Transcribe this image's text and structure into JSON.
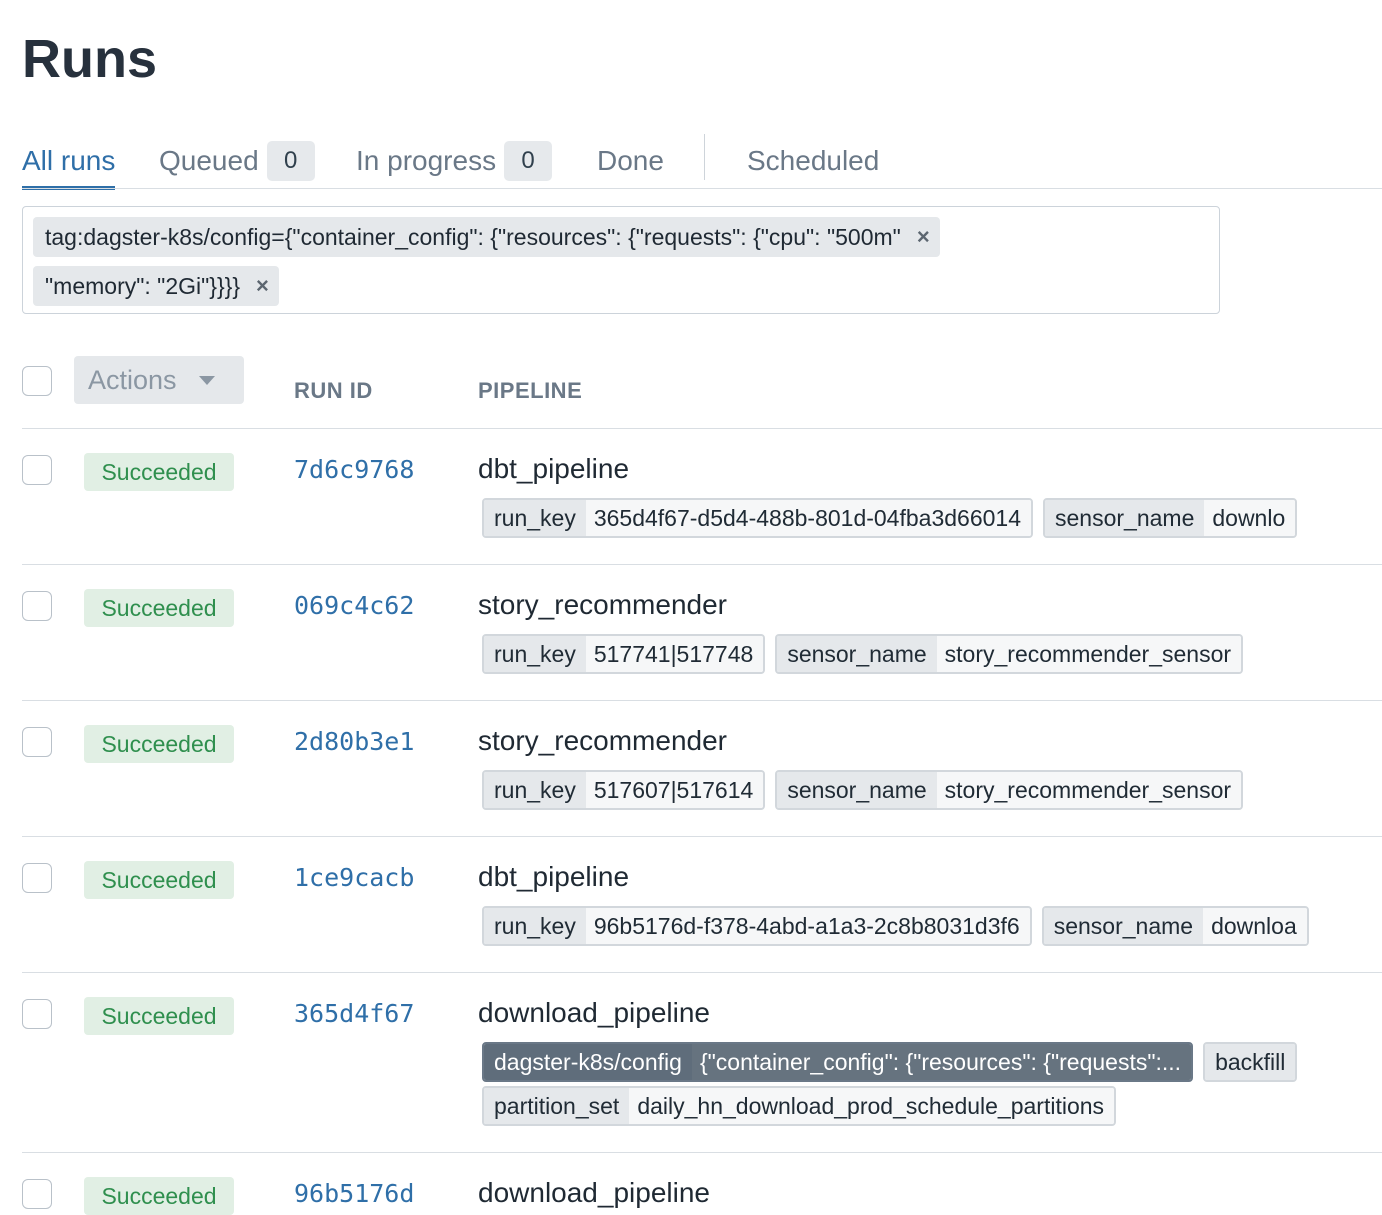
{
  "page": {
    "title": "Runs"
  },
  "tabs": [
    {
      "label": "All runs",
      "active": true
    },
    {
      "label": "Queued",
      "count": "0"
    },
    {
      "label": "In progress",
      "count": "0"
    },
    {
      "label": "Done"
    },
    {
      "label": "Scheduled"
    }
  ],
  "filter": {
    "line1": "tag:dagster-k8s/config={\"container_config\": {\"resources\": {\"requests\": {\"cpu\": \"500m\"",
    "line2": "\"memory\": \"2Gi\"}}}}",
    "remove_icon": "×"
  },
  "table": {
    "actions_label": "Actions",
    "col_run_id": "RUN ID",
    "col_pipeline": "PIPELINE"
  },
  "rows": [
    {
      "status": "Succeeded",
      "run_id": "7d6c9768",
      "pipeline": "dbt_pipeline",
      "tags": [
        {
          "k": "run_key",
          "v": "365d4f67-d5d4-488b-801d-04fba3d66014"
        },
        {
          "k": "sensor_name",
          "v": "downlo"
        }
      ]
    },
    {
      "status": "Succeeded",
      "run_id": "069c4c62",
      "pipeline": "story_recommender",
      "tags": [
        {
          "k": "run_key",
          "v": "517741|517748"
        },
        {
          "k": "sensor_name",
          "v": "story_recommender_sensor"
        }
      ]
    },
    {
      "status": "Succeeded",
      "run_id": "2d80b3e1",
      "pipeline": "story_recommender",
      "tags": [
        {
          "k": "run_key",
          "v": "517607|517614"
        },
        {
          "k": "sensor_name",
          "v": "story_recommender_sensor"
        }
      ]
    },
    {
      "status": "Succeeded",
      "run_id": "1ce9cacb",
      "pipeline": "dbt_pipeline",
      "tags": [
        {
          "k": "run_key",
          "v": "96b5176d-f378-4abd-a1a3-2c8b8031d3f6"
        },
        {
          "k": "sensor_name",
          "v": "downloa"
        }
      ]
    },
    {
      "status": "Succeeded",
      "run_id": "365d4f67",
      "pipeline": "download_pipeline",
      "tags": [
        {
          "k": "dagster-k8s/config",
          "v": "{\"container_config\": {\"resources\": {\"requests\":..."
        },
        {
          "k": "backfill"
        }
      ],
      "tags2": [
        {
          "k": "partition_set",
          "v": "daily_hn_download_prod_schedule_partitions"
        }
      ]
    },
    {
      "status": "Succeeded",
      "run_id": "96b5176d",
      "pipeline": "download_pipeline"
    }
  ]
}
